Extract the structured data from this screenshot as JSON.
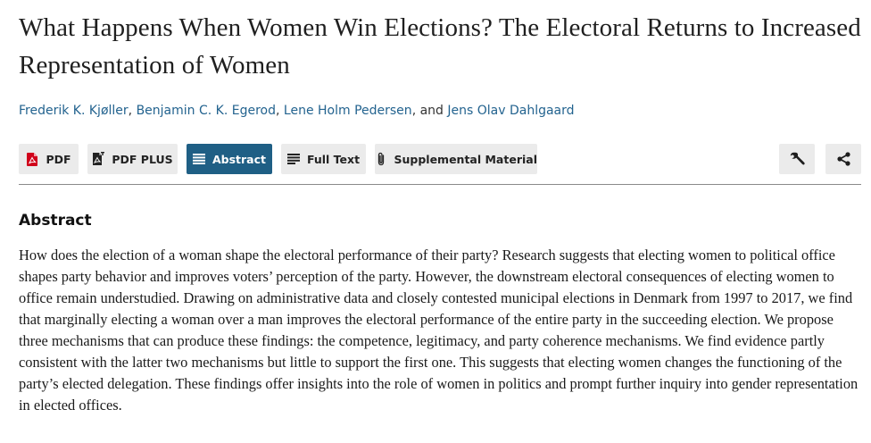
{
  "article": {
    "title": "What Happens When Women Win Elections? The Electoral Returns to Increased Representation of Women"
  },
  "authors": {
    "list": [
      "Frederik K. Kjøller",
      "Benjamin C. K. Egerod",
      "Lene Holm Pedersen",
      "Jens Olav Dahlgaard"
    ],
    "separator": ", ",
    "last_separator": ", and "
  },
  "toolbar": {
    "pdf_label": "PDF",
    "pdf_plus_label": "PDF PLUS",
    "abstract_label": "Abstract",
    "full_text_label": "Full Text",
    "supplemental_label": "Supplemental Material",
    "icons": {
      "pdf": "pdf-icon",
      "pdf_plus": "pdf-plus-icon",
      "abstract": "list-icon",
      "full_text": "text-lines-icon",
      "supplemental": "paperclip-icon",
      "tools": "wrench-icon",
      "share": "share-icon"
    },
    "colors": {
      "active_bg": "#1f5f85",
      "button_bg": "#ebebeb",
      "pdf_red": "#d0021b",
      "link_blue": "#23638f"
    }
  },
  "abstract": {
    "heading": "Abstract",
    "text": "How does the election of a woman shape the electoral performance of their party? Research suggests that electing women to political office shapes party behavior and improves voters’ perception of the party. However, the downstream electoral consequences of electing women to office remain understudied. Drawing on administrative data and closely contested municipal elections in Denmark from 1997 to 2017, we find that marginally electing a woman over a man improves the electoral performance of the entire party in the succeeding election. We propose three mechanisms that can produce these findings: the competence, legitimacy, and party coherence mechanisms. We find evidence partly consistent with the latter two mechanisms but little to support the first one. This suggests that electing women changes the functioning of the party’s elected delegation. These findings offer insights into the role of women in politics and prompt further inquiry into gender representation in elected offices."
  }
}
